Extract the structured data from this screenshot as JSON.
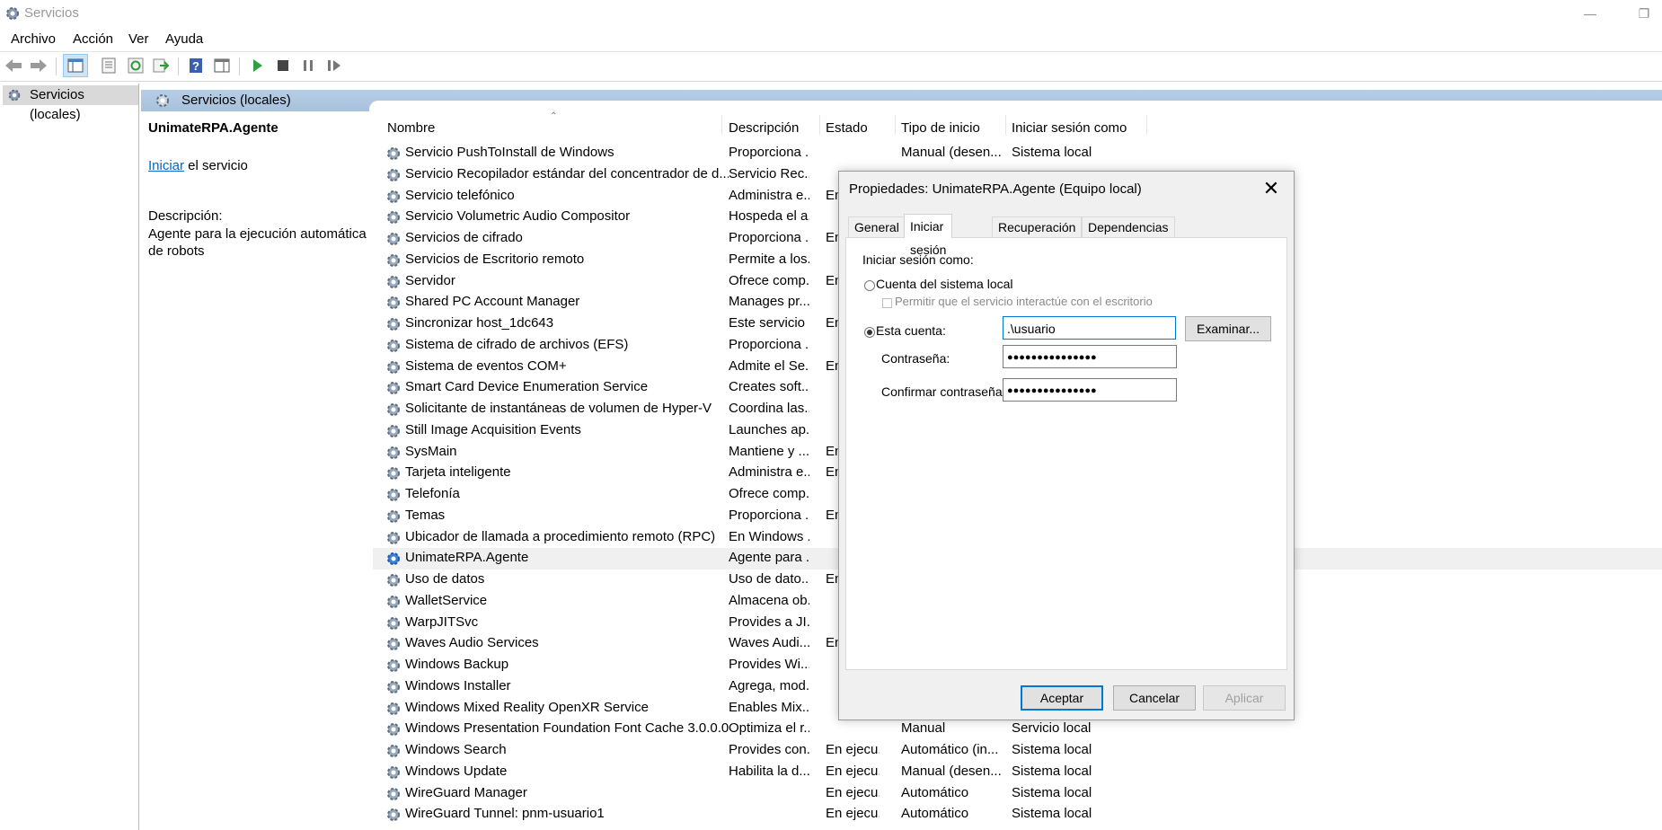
{
  "window": {
    "title": "Servicios"
  },
  "menu": [
    "Archivo",
    "Acción",
    "Ver",
    "Ayuda"
  ],
  "tree": {
    "node": "Servicios (locales)"
  },
  "content_header": "Servicios (locales)",
  "desc_pane": {
    "service_name": "UnimateRPA.Agente",
    "start_link": "Iniciar",
    "start_suffix": " el servicio",
    "description_label": "Descripción:",
    "description_text": "Agente para la ejecución automática de robots"
  },
  "columns": [
    "Nombre",
    "Descripción",
    "Estado",
    "Tipo de inicio",
    "Iniciar sesión como"
  ],
  "rows": [
    {
      "name": "Servicio PushToInstall de Windows",
      "desc": "Proporciona ...",
      "state": "",
      "start": "Manual (desen...",
      "logon": "Sistema local"
    },
    {
      "name": "Servicio Recopilador estándar del concentrador de d...",
      "desc": "Servicio Rec...",
      "state": "",
      "start": "",
      "logon": ""
    },
    {
      "name": "Servicio telefónico",
      "desc": "Administra e...",
      "state": "En",
      "start": "",
      "logon": ""
    },
    {
      "name": "Servicio Volumetric Audio Compositor",
      "desc": "Hospeda el a...",
      "state": "",
      "start": "",
      "logon": ""
    },
    {
      "name": "Servicios de cifrado",
      "desc": "Proporciona ...",
      "state": "En",
      "start": "",
      "logon": ""
    },
    {
      "name": "Servicios de Escritorio remoto",
      "desc": "Permite a los...",
      "state": "",
      "start": "",
      "logon": ""
    },
    {
      "name": "Servidor",
      "desc": "Ofrece comp...",
      "state": "En",
      "start": "",
      "logon": ""
    },
    {
      "name": "Shared PC Account Manager",
      "desc": "Manages pr...",
      "state": "",
      "start": "",
      "logon": ""
    },
    {
      "name": "Sincronizar host_1dc643",
      "desc": "Este servicio ...",
      "state": "En",
      "start": "",
      "logon": ""
    },
    {
      "name": "Sistema de cifrado de archivos (EFS)",
      "desc": "Proporciona ...",
      "state": "",
      "start": "",
      "logon": ""
    },
    {
      "name": "Sistema de eventos COM+",
      "desc": "Admite el Se...",
      "state": "En",
      "start": "",
      "logon": ""
    },
    {
      "name": "Smart Card Device Enumeration Service",
      "desc": "Creates soft...",
      "state": "",
      "start": "",
      "logon": ""
    },
    {
      "name": "Solicitante de instantáneas de volumen de Hyper-V",
      "desc": "Coordina las...",
      "state": "",
      "start": "",
      "logon": ""
    },
    {
      "name": "Still Image Acquisition Events",
      "desc": "Launches ap...",
      "state": "",
      "start": "",
      "logon": ""
    },
    {
      "name": "SysMain",
      "desc": "Mantiene y ...",
      "state": "En",
      "start": "",
      "logon": ""
    },
    {
      "name": "Tarjeta inteligente",
      "desc": "Administra e...",
      "state": "En",
      "start": "",
      "logon": ""
    },
    {
      "name": "Telefonía",
      "desc": "Ofrece comp...",
      "state": "",
      "start": "",
      "logon": ""
    },
    {
      "name": "Temas",
      "desc": "Proporciona ...",
      "state": "En",
      "start": "",
      "logon": ""
    },
    {
      "name": "Ubicador de llamada a procedimiento remoto (RPC)",
      "desc": "En Windows ...",
      "state": "",
      "start": "",
      "logon": ""
    },
    {
      "name": "UnimateRPA.Agente",
      "desc": "Agente para ...",
      "state": "",
      "start": "",
      "logon": "",
      "selected": true
    },
    {
      "name": "Uso de datos",
      "desc": "Uso de dato...",
      "state": "En",
      "start": "",
      "logon": ""
    },
    {
      "name": "WalletService",
      "desc": "Almacena ob...",
      "state": "",
      "start": "",
      "logon": ""
    },
    {
      "name": "WarpJITSvc",
      "desc": "Provides a JI...",
      "state": "",
      "start": "",
      "logon": ""
    },
    {
      "name": "Waves Audio Services",
      "desc": "Waves Audi...",
      "state": "En",
      "start": "",
      "logon": ""
    },
    {
      "name": "Windows Backup",
      "desc": "Provides Wi...",
      "state": "",
      "start": "",
      "logon": ""
    },
    {
      "name": "Windows Installer",
      "desc": "Agrega, mod...",
      "state": "",
      "start": "",
      "logon": ""
    },
    {
      "name": "Windows Mixed Reality OpenXR Service",
      "desc": "Enables Mix...",
      "state": "",
      "start": "",
      "logon": ""
    },
    {
      "name": "Windows Presentation Foundation Font Cache 3.0.0.0",
      "desc": "Optimiza el r...",
      "state": "",
      "start": "Manual",
      "logon": "Servicio local"
    },
    {
      "name": "Windows Search",
      "desc": "Provides con...",
      "state": "En ejecu...",
      "start": "Automático (in...",
      "logon": "Sistema local"
    },
    {
      "name": "Windows Update",
      "desc": "Habilita la d...",
      "state": "En ejecu...",
      "start": "Manual (desen...",
      "logon": "Sistema local"
    },
    {
      "name": "WireGuard Manager",
      "desc": "",
      "state": "En ejecu...",
      "start": "Automático",
      "logon": "Sistema local"
    },
    {
      "name": "WireGuard Tunnel: pnm-usuario1",
      "desc": "",
      "state": "En ejecu...",
      "start": "Automático",
      "logon": "Sistema local"
    }
  ],
  "dialog": {
    "title": "Propiedades: UnimateRPA.Agente (Equipo local)",
    "tabs": [
      "General",
      "Iniciar sesión",
      "Recuperación",
      "Dependencias"
    ],
    "logon_as_label": "Iniciar sesión como:",
    "local_system_label": "Cuenta del sistema local",
    "interact_label": "Permitir que el servicio interactúe con el escritorio",
    "this_account_label": "Esta cuenta:",
    "account_value": ".\\usuario",
    "browse_button": "Examinar...",
    "password_label": "Contraseña:",
    "password_value": "●●●●●●●●●●●●●●●",
    "confirm_label": "Confirmar contraseña:",
    "confirm_value": "●●●●●●●●●●●●●●●",
    "ok_button": "Aceptar",
    "cancel_button": "Cancelar",
    "apply_button": "Aplicar"
  },
  "colors": {
    "accent": "#0078d7",
    "header_band": "#b6cde4",
    "link": "#0066cc"
  }
}
